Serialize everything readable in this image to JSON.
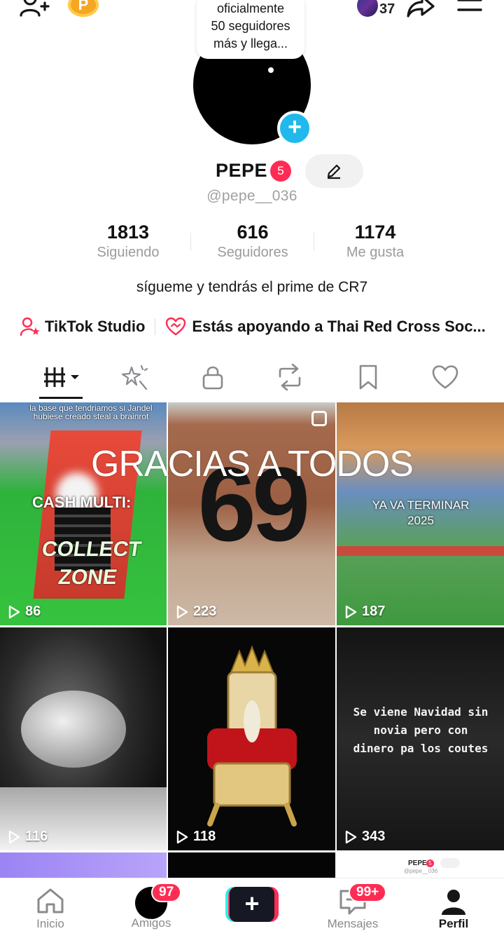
{
  "status_bubble": {
    "lines": [
      "oficialmente",
      "50 seguidores",
      "más y llega..."
    ]
  },
  "top_bar": {
    "coin_letter": "P",
    "views_count": "37"
  },
  "profile": {
    "name": "PEPE",
    "badge": "5",
    "handle": "@pepe__036",
    "bio": "sígueme y tendrás el prime de CR7"
  },
  "stats": [
    {
      "value": "1813",
      "label": "Siguiendo"
    },
    {
      "value": "616",
      "label": "Seguidores"
    },
    {
      "value": "1174",
      "label": "Me gusta"
    }
  ],
  "links": {
    "studio": "TikTok Studio",
    "charity": "Estás apoyando a Thai Red Cross Soc..."
  },
  "tabs": [
    "videos",
    "reposts-sparkle",
    "private",
    "repost",
    "favorites",
    "liked"
  ],
  "grid": {
    "overlay_title": "GRACIAS A TODOS",
    "tiles": [
      {
        "views": "86",
        "caption": "la base que tendriamos si Jandel hubiese creado steal a brainrot",
        "sign": "CASH MULTI:",
        "zone": "COLLECT ZONE"
      },
      {
        "views": "223",
        "big_text": "69"
      },
      {
        "views": "187",
        "caption": "YA VA TERMINAR 2025"
      },
      {
        "views": "116"
      },
      {
        "views": "118"
      },
      {
        "views": "343",
        "caption": "Se viene Navidad sin novia pero con dinero pa los coutes"
      }
    ],
    "peek_profile": {
      "name": "PEPE",
      "badge": "5",
      "handle": "@pepe__036"
    }
  },
  "bottom_nav": {
    "home": "Inicio",
    "friends": "Amigos",
    "friends_badge": "97",
    "messages": "Mensajes",
    "messages_badge": "99+",
    "profile": "Perfil"
  },
  "colors": {
    "accent_red": "#fe2c55",
    "add_blue": "#21b9ec",
    "coin_gold": "#f5a623"
  }
}
